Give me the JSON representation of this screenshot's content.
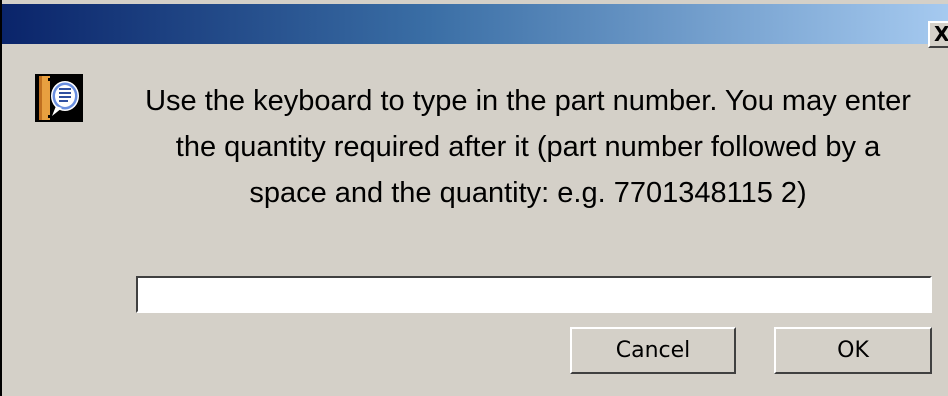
{
  "window": {
    "close_label": "X",
    "icon": "info-document-icon",
    "colors": {
      "title_gradient_start": "#0a246a",
      "title_gradient_end": "#a6caf0",
      "dialog_background": "#d4d0c8"
    }
  },
  "message": {
    "line1": "Use the keyboard to type in the part number. You may enter",
    "line2": "the quantity required after it (part number followed by a",
    "line3": "space and the quantity: e.g. 7701348115 2)"
  },
  "input": {
    "value": "",
    "placeholder": ""
  },
  "buttons": {
    "cancel_label": "Cancel",
    "ok_label": "OK"
  }
}
